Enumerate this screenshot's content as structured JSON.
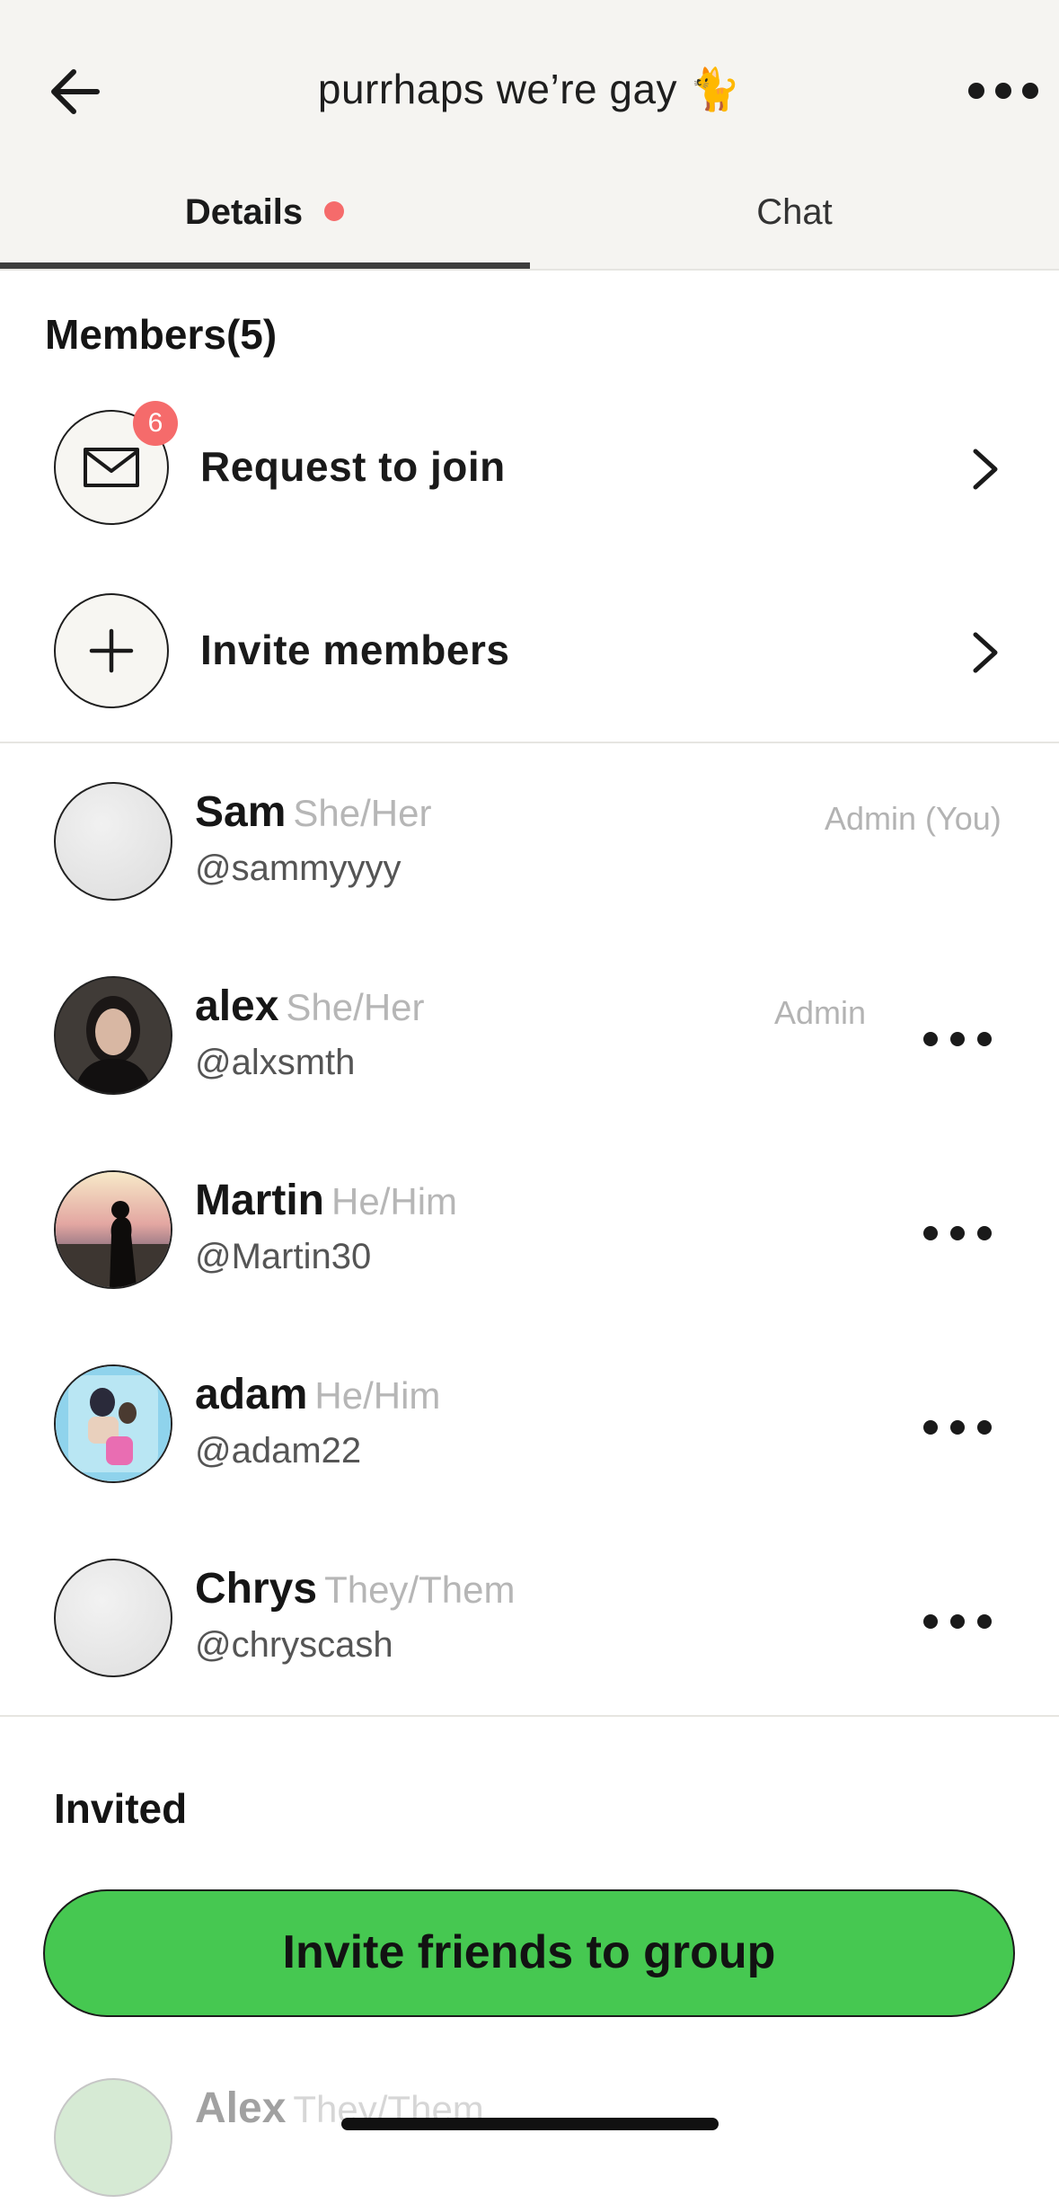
{
  "header": {
    "title": "purrhaps we’re gay 🐈",
    "back_icon": "arrow-left-icon",
    "more_icon": "more-horizontal-icon"
  },
  "tabs": [
    {
      "label": "Details",
      "active": true,
      "has_dot": true
    },
    {
      "label": "Chat",
      "active": false
    }
  ],
  "members_section": {
    "title": "Members(5)"
  },
  "actions": [
    {
      "label": "Request to join",
      "icon": "mail-icon",
      "badge": "6"
    },
    {
      "label": "Invite members",
      "icon": "plus-icon"
    }
  ],
  "members": [
    {
      "name": "Sam",
      "pronouns": "She/Her",
      "handle": "@sammyyyy",
      "role": "Admin (You)",
      "avatar": "blank"
    },
    {
      "name": "alex",
      "pronouns": "She/Her",
      "handle": "@alxsmth",
      "role": "Admin",
      "avatar": "photo-portrait"
    },
    {
      "name": "Martin",
      "pronouns": "He/Him",
      "handle": "@Martin30",
      "role": "",
      "avatar": "photo-sunset"
    },
    {
      "name": "adam",
      "pronouns": "He/Him",
      "handle": "@adam22",
      "role": "",
      "avatar": "photo-illustration"
    },
    {
      "name": "Chrys",
      "pronouns": "They/Them",
      "handle": "@chryscash",
      "role": "",
      "avatar": "blank"
    }
  ],
  "invited_section": {
    "title": "Invited"
  },
  "invited": [
    {
      "name": "Alex",
      "pronouns": "They/Them"
    }
  ],
  "invite_button": {
    "label": "Invite friends to group",
    "color": "#46c851"
  },
  "colors": {
    "header_bg": "#f5f4f1",
    "badge": "#f56b6b",
    "accent_green": "#46c851"
  }
}
